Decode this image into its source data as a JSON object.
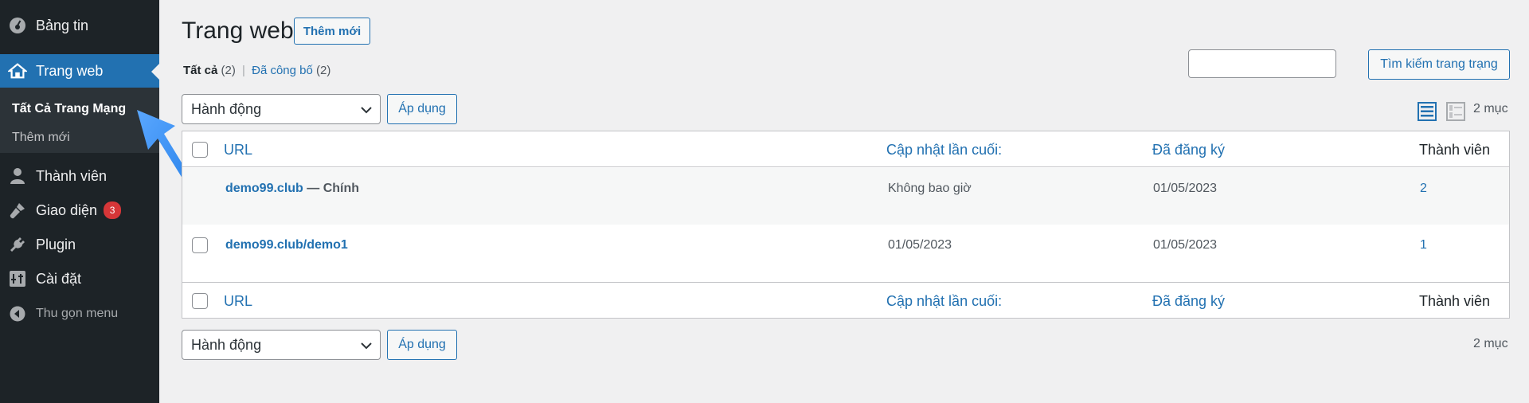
{
  "sidebar": {
    "items": [
      {
        "label": "Bảng tin",
        "icon": "dashboard-icon"
      },
      {
        "label": "Trang web",
        "icon": "sites-icon"
      },
      {
        "label": "Thành viên",
        "icon": "users-icon"
      },
      {
        "label": "Giao diện",
        "icon": "appearance-icon",
        "badge": "3"
      },
      {
        "label": "Plugin",
        "icon": "plugin-icon"
      },
      {
        "label": "Cài đặt",
        "icon": "settings-icon"
      }
    ],
    "submenu": [
      {
        "label": "Tất Cả Trang Mạng",
        "current": true
      },
      {
        "label": "Thêm mới",
        "current": false
      }
    ],
    "collapse_label": "Thu gọn menu",
    "accent": "#2271b1"
  },
  "header": {
    "title": "Trang web",
    "add_new_label": "Thêm mới"
  },
  "filters": {
    "all_label": "Tất cả",
    "all_count": "(2)",
    "separator": "|",
    "published_label": "Đã công bố",
    "published_count": "(2)"
  },
  "search": {
    "value": "",
    "button_label": "Tìm kiếm trang trạng"
  },
  "bulk": {
    "select_value": "Hành động",
    "apply_label": "Áp dụng"
  },
  "item_count": "2 mục",
  "table": {
    "columns": [
      "URL",
      "Cập nhật lần cuối:",
      "Đã đăng ký",
      "Thành viên"
    ],
    "rows": [
      {
        "url": "demo99.club",
        "suffix": " — Chính",
        "updated": "Không bao giờ",
        "registered": "01/05/2023",
        "users": "2"
      },
      {
        "url": "demo99.club/demo1",
        "suffix": "",
        "updated": "01/05/2023",
        "registered": "01/05/2023",
        "users": "1"
      }
    ]
  }
}
